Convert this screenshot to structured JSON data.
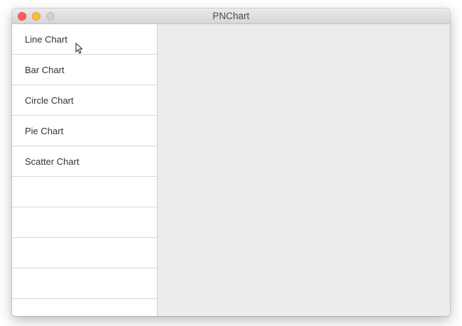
{
  "window": {
    "title": "PNChart"
  },
  "sidebar": {
    "items": [
      {
        "label": "Line Chart"
      },
      {
        "label": "Bar Chart"
      },
      {
        "label": "Circle Chart"
      },
      {
        "label": "Pie Chart"
      },
      {
        "label": "Scatter Chart"
      },
      {
        "label": ""
      },
      {
        "label": ""
      },
      {
        "label": ""
      },
      {
        "label": ""
      }
    ]
  },
  "colors": {
    "close_button": "#fc605c",
    "minimize_button": "#fdbc40",
    "zoom_button_disabled": "#d0d0d0",
    "content_background": "#ececec"
  },
  "icons": {
    "cursor": "mouse-pointer-icon"
  }
}
